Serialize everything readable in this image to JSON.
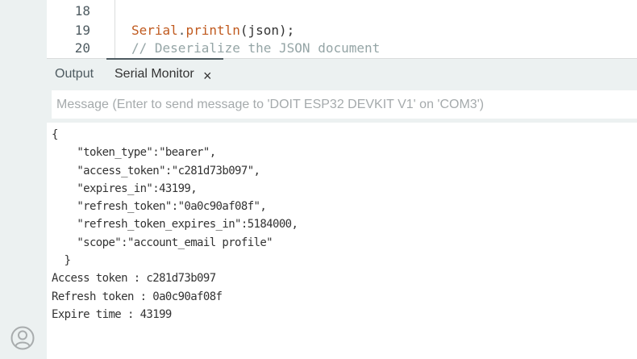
{
  "editor": {
    "lines": [
      {
        "num": "18",
        "code": ""
      },
      {
        "num": "19",
        "code": "Serial.println(json);"
      },
      {
        "num": "20",
        "code": "// Deserialize the JSON document"
      }
    ]
  },
  "panel": {
    "tabs": [
      {
        "label": "Output"
      },
      {
        "label": "Serial Monitor"
      }
    ],
    "close_icon": "×"
  },
  "message": {
    "placeholder": "Message (Enter to send message to 'DOIT ESP32 DEVKIT V1' on 'COM3')",
    "value": ""
  },
  "output": {
    "lines": [
      "{",
      "    \"token_type\":\"bearer\",",
      "    \"access_token\":\"c281d73b097\",",
      "    \"expires_in\":43199,",
      "    \"refresh_token\":\"0a0c90af08f\",",
      "    \"refresh_token_expires_in\":5184000,",
      "    \"scope\":\"account_email profile\"",
      "  }",
      "Access token : c281d73b097",
      "Refresh token : 0a0c90af08f",
      "Expire time : 43199"
    ]
  },
  "colors": {
    "keyword": "#c05a1f",
    "comment": "#95a5a6",
    "sidebar": "#ecf1f1"
  }
}
